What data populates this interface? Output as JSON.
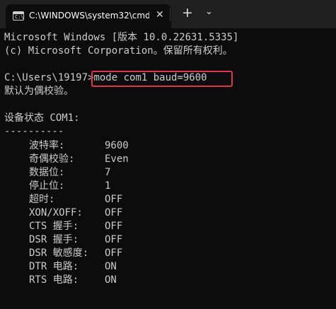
{
  "window": {
    "tab_title": "C:\\WINDOWS\\system32\\cmd.",
    "tab_icon_glyph": "C:\\",
    "close_glyph": "✕",
    "new_tab_glyph": "+",
    "dropdown_glyph": "⌄"
  },
  "console": {
    "header_line1": "Microsoft Windows [版本 10.0.22631.5335]",
    "header_line2": "(c) Microsoft Corporation。保留所有权利。",
    "prompt": "C:\\Users\\19197>",
    "command": "mode com1 baud=9600",
    "response": "默认为偶校验。",
    "status_title": "设备状态 COM1:",
    "separator": "----------",
    "status_rows": [
      {
        "label": "波特率:",
        "value": "9600"
      },
      {
        "label": "奇偶校验:",
        "value": "Even"
      },
      {
        "label": "数据位:",
        "value": "7"
      },
      {
        "label": "停止位:",
        "value": "1"
      },
      {
        "label": "超时:",
        "value": "OFF"
      },
      {
        "label": "XON/XOFF:",
        "value": "OFF"
      },
      {
        "label": "CTS 握手:",
        "value": "OFF"
      },
      {
        "label": "DSR 握手:",
        "value": "OFF"
      },
      {
        "label": "DSR 敏感度:",
        "value": "OFF"
      },
      {
        "label": "DTR 电路:",
        "value": "ON"
      },
      {
        "label": "RTS 电路:",
        "value": "ON"
      }
    ]
  },
  "colors": {
    "console_bg": "#0c0c0c",
    "console_text": "#cccccc",
    "titlebar_bg": "#202020",
    "highlight_border": "#e0364e"
  }
}
